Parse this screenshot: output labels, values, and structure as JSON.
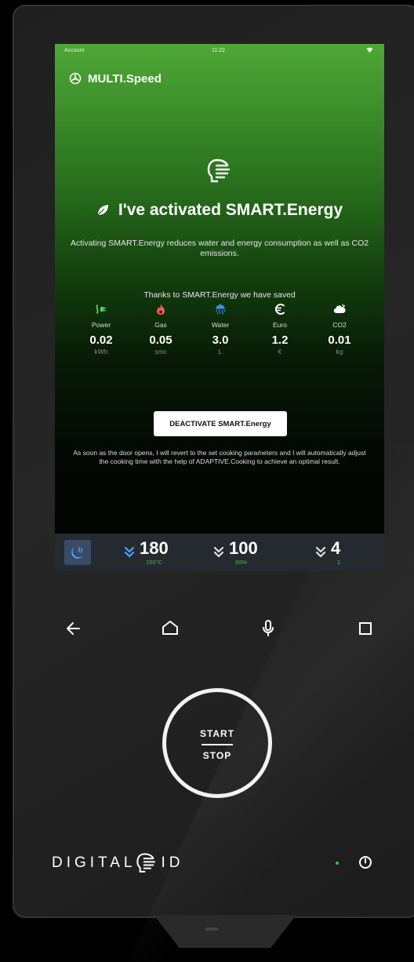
{
  "status_bar": {
    "account": "Account",
    "time": "11:22",
    "wifi_icon": "wifi-icon"
  },
  "app": {
    "title": "MULTI.Speed",
    "icon": "multispeed-fan-icon"
  },
  "hero": {
    "icon": "smart-energy-face-icon",
    "leaf_icon": "leaf-icon",
    "headline": "I've activated SMART.Energy",
    "description": "Activating SMART.Energy reduces water and energy consumption as well as CO2 emissions.",
    "thanks": "Thanks to SMART.Energy we have saved"
  },
  "stats": [
    {
      "label": "Power",
      "value": "0.02",
      "unit": "kWh",
      "icon": "power-plug-icon",
      "color": "#4cd964"
    },
    {
      "label": "Gas",
      "value": "0.05",
      "unit": "smc",
      "icon": "flame-icon",
      "color": "#ff5a4e"
    },
    {
      "label": "Water",
      "value": "3.0",
      "unit": "L",
      "icon": "shower-icon",
      "color": "#3a8fe8"
    },
    {
      "label": "Euro",
      "value": "1.2",
      "unit": "€",
      "icon": "euro-icon",
      "color": "#ffffff"
    },
    {
      "label": "CO2",
      "value": "0.01",
      "unit": "kg",
      "icon": "cloud-co2-icon",
      "color": "#ffffff"
    }
  ],
  "deactivate_button": "DEACTIVATE SMART.Energy",
  "note": "As soon as the door opens, I will revert to the set cooking parameters and I will automatically adjust the cooking time with the help of ADAPTIVE.Cooking to achieve an optimal result.",
  "bottom_bar": {
    "mode_icon": "steam-convection-icon",
    "params": [
      {
        "value": "180",
        "sub": "150°C"
      },
      {
        "value": "100",
        "sub": "60%"
      },
      {
        "value": "4",
        "sub": "1"
      }
    ]
  },
  "nav": {
    "back": "back-arrow-icon",
    "home": "home-icon",
    "mic": "microphone-icon",
    "square": "recent-apps-icon"
  },
  "start_stop": {
    "start": "START",
    "stop": "STOP"
  },
  "brand": {
    "left": "DIGITAL",
    "right": "ID"
  },
  "colors": {
    "accent_green": "#3cc043",
    "screen_top": "#4fa836",
    "bar_bg": "#252a30",
    "mode_btn": "#3a4b66",
    "chevron_blue": "#4aa3ff"
  }
}
